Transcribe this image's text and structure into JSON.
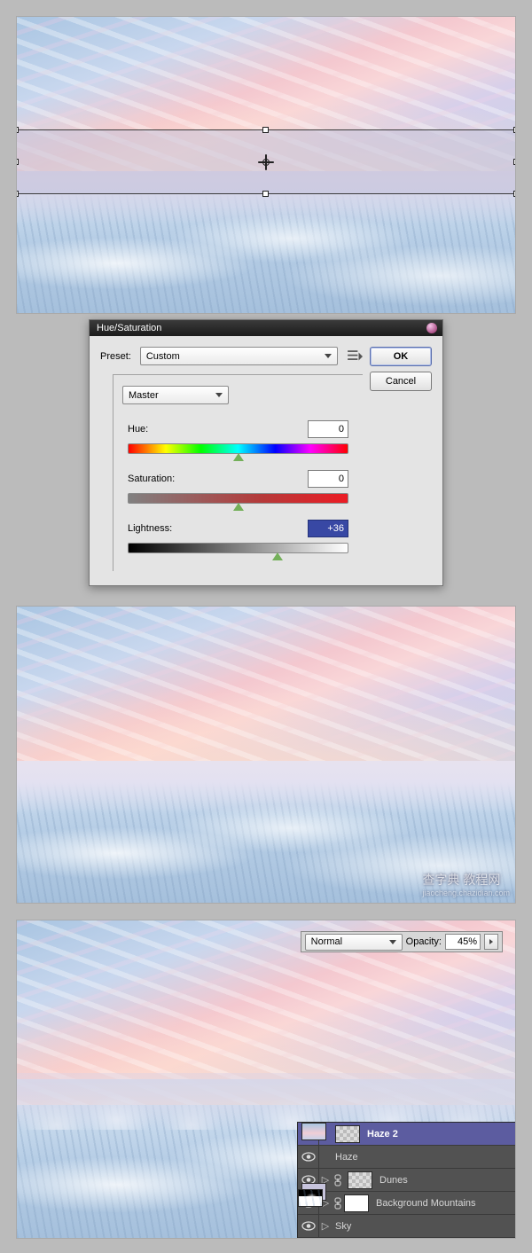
{
  "dialog": {
    "title": "Hue/Saturation",
    "preset_label": "Preset:",
    "preset_value": "Custom",
    "master_value": "Master",
    "hue_label": "Hue:",
    "hue_value": "0",
    "sat_label": "Saturation:",
    "sat_value": "0",
    "light_label": "Lightness:",
    "light_value": "+36",
    "ok": "OK",
    "cancel": "Cancel"
  },
  "opacityPanel": {
    "blend_mode": "Normal",
    "opacity_label": "Opacity:",
    "opacity_value": "45%"
  },
  "layers": [
    {
      "name": "Haze 2",
      "selected": true,
      "expand": false,
      "mask": false,
      "thumb": "checker"
    },
    {
      "name": "Haze",
      "selected": false,
      "expand": false,
      "mask": false,
      "thumb": "haze"
    },
    {
      "name": "Dunes",
      "selected": false,
      "expand": true,
      "mask": "dunes",
      "thumb": "checker"
    },
    {
      "name": "Background Mountains",
      "selected": false,
      "expand": true,
      "mask": "white",
      "thumb": "sky"
    },
    {
      "name": "Sky",
      "selected": false,
      "expand": true,
      "mask": false,
      "thumb": "sky"
    }
  ],
  "watermark": {
    "line1": "查字典 教程网",
    "line2": "jiaocheng.chazidian.com"
  }
}
